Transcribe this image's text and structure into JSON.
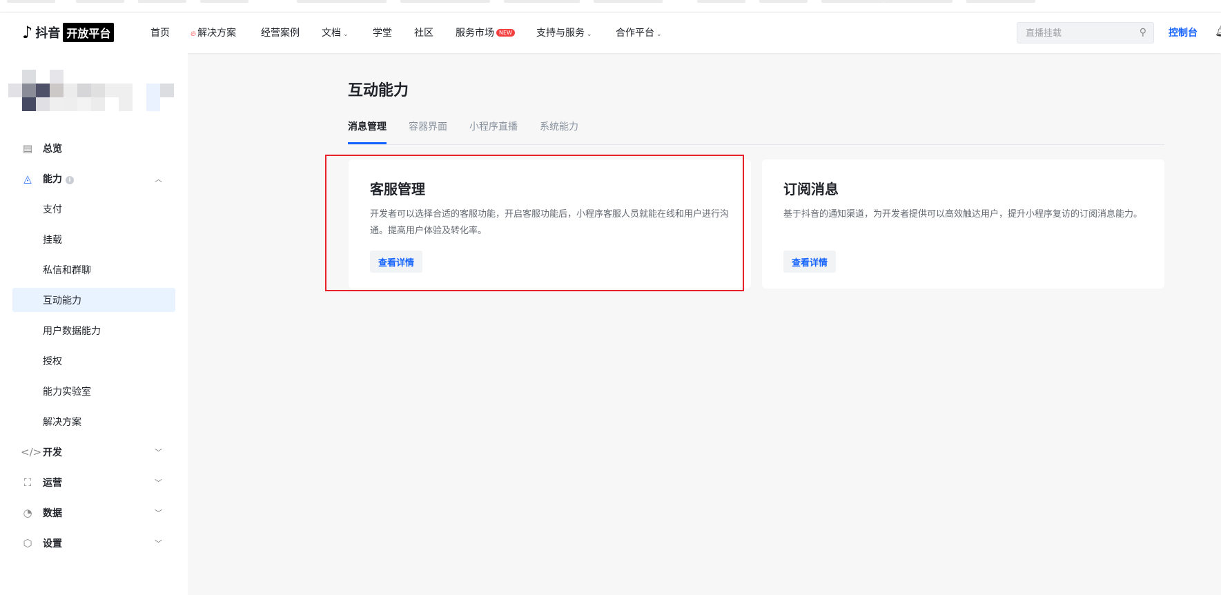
{
  "header": {
    "logo_brand": "抖音",
    "logo_platform": "开放平台",
    "nav": [
      {
        "label": "首页"
      },
      {
        "label": "解决方案",
        "icon": "fire-icon"
      },
      {
        "label": "经营案例"
      },
      {
        "label": "文档",
        "dropdown": true
      },
      {
        "label": "学堂"
      },
      {
        "label": "社区"
      },
      {
        "label": "服务市场",
        "badge": "NEW"
      },
      {
        "label": "支持与服务",
        "dropdown": true
      },
      {
        "label": "合作平台",
        "dropdown": true
      }
    ],
    "search_placeholder": "直播挂载",
    "console": "控制台"
  },
  "sidebar": {
    "items": [
      {
        "label": "总览",
        "icon": "overview-icon"
      },
      {
        "label": "能力",
        "icon": "capability-icon",
        "expanded": true
      },
      {
        "label": "支付"
      },
      {
        "label": "挂载"
      },
      {
        "label": "私信和群聊"
      },
      {
        "label": "互动能力",
        "active": true
      },
      {
        "label": "用户数据能力"
      },
      {
        "label": "授权"
      },
      {
        "label": "能力实验室"
      },
      {
        "label": "解决方案"
      },
      {
        "label": "开发",
        "icon": "code-icon"
      },
      {
        "label": "运营",
        "icon": "presentation-icon"
      },
      {
        "label": "数据",
        "icon": "pie-chart-icon"
      },
      {
        "label": "设置",
        "icon": "settings-icon"
      }
    ]
  },
  "main": {
    "title": "互动能力",
    "tabs": [
      {
        "label": "消息管理",
        "active": true
      },
      {
        "label": "容器界面"
      },
      {
        "label": "小程序直播"
      },
      {
        "label": "系统能力"
      }
    ],
    "cards": [
      {
        "title": "客服管理",
        "desc": "开发者可以选择合适的客服功能，开启客服功能后，小程序客服人员就能在线和用户进行沟通。提高用户体验及转化率。",
        "button": "查看详情",
        "highlighted": true
      },
      {
        "title": "订阅消息",
        "desc": "基于抖音的通知渠道，为开发者提供可以高效触达用户，提升小程序复访的订阅消息能力。",
        "button": "查看详情"
      }
    ]
  },
  "colors": {
    "accent": "#1664ff",
    "highlight": "#e8202a",
    "active_bg": "#e8f3ff"
  }
}
